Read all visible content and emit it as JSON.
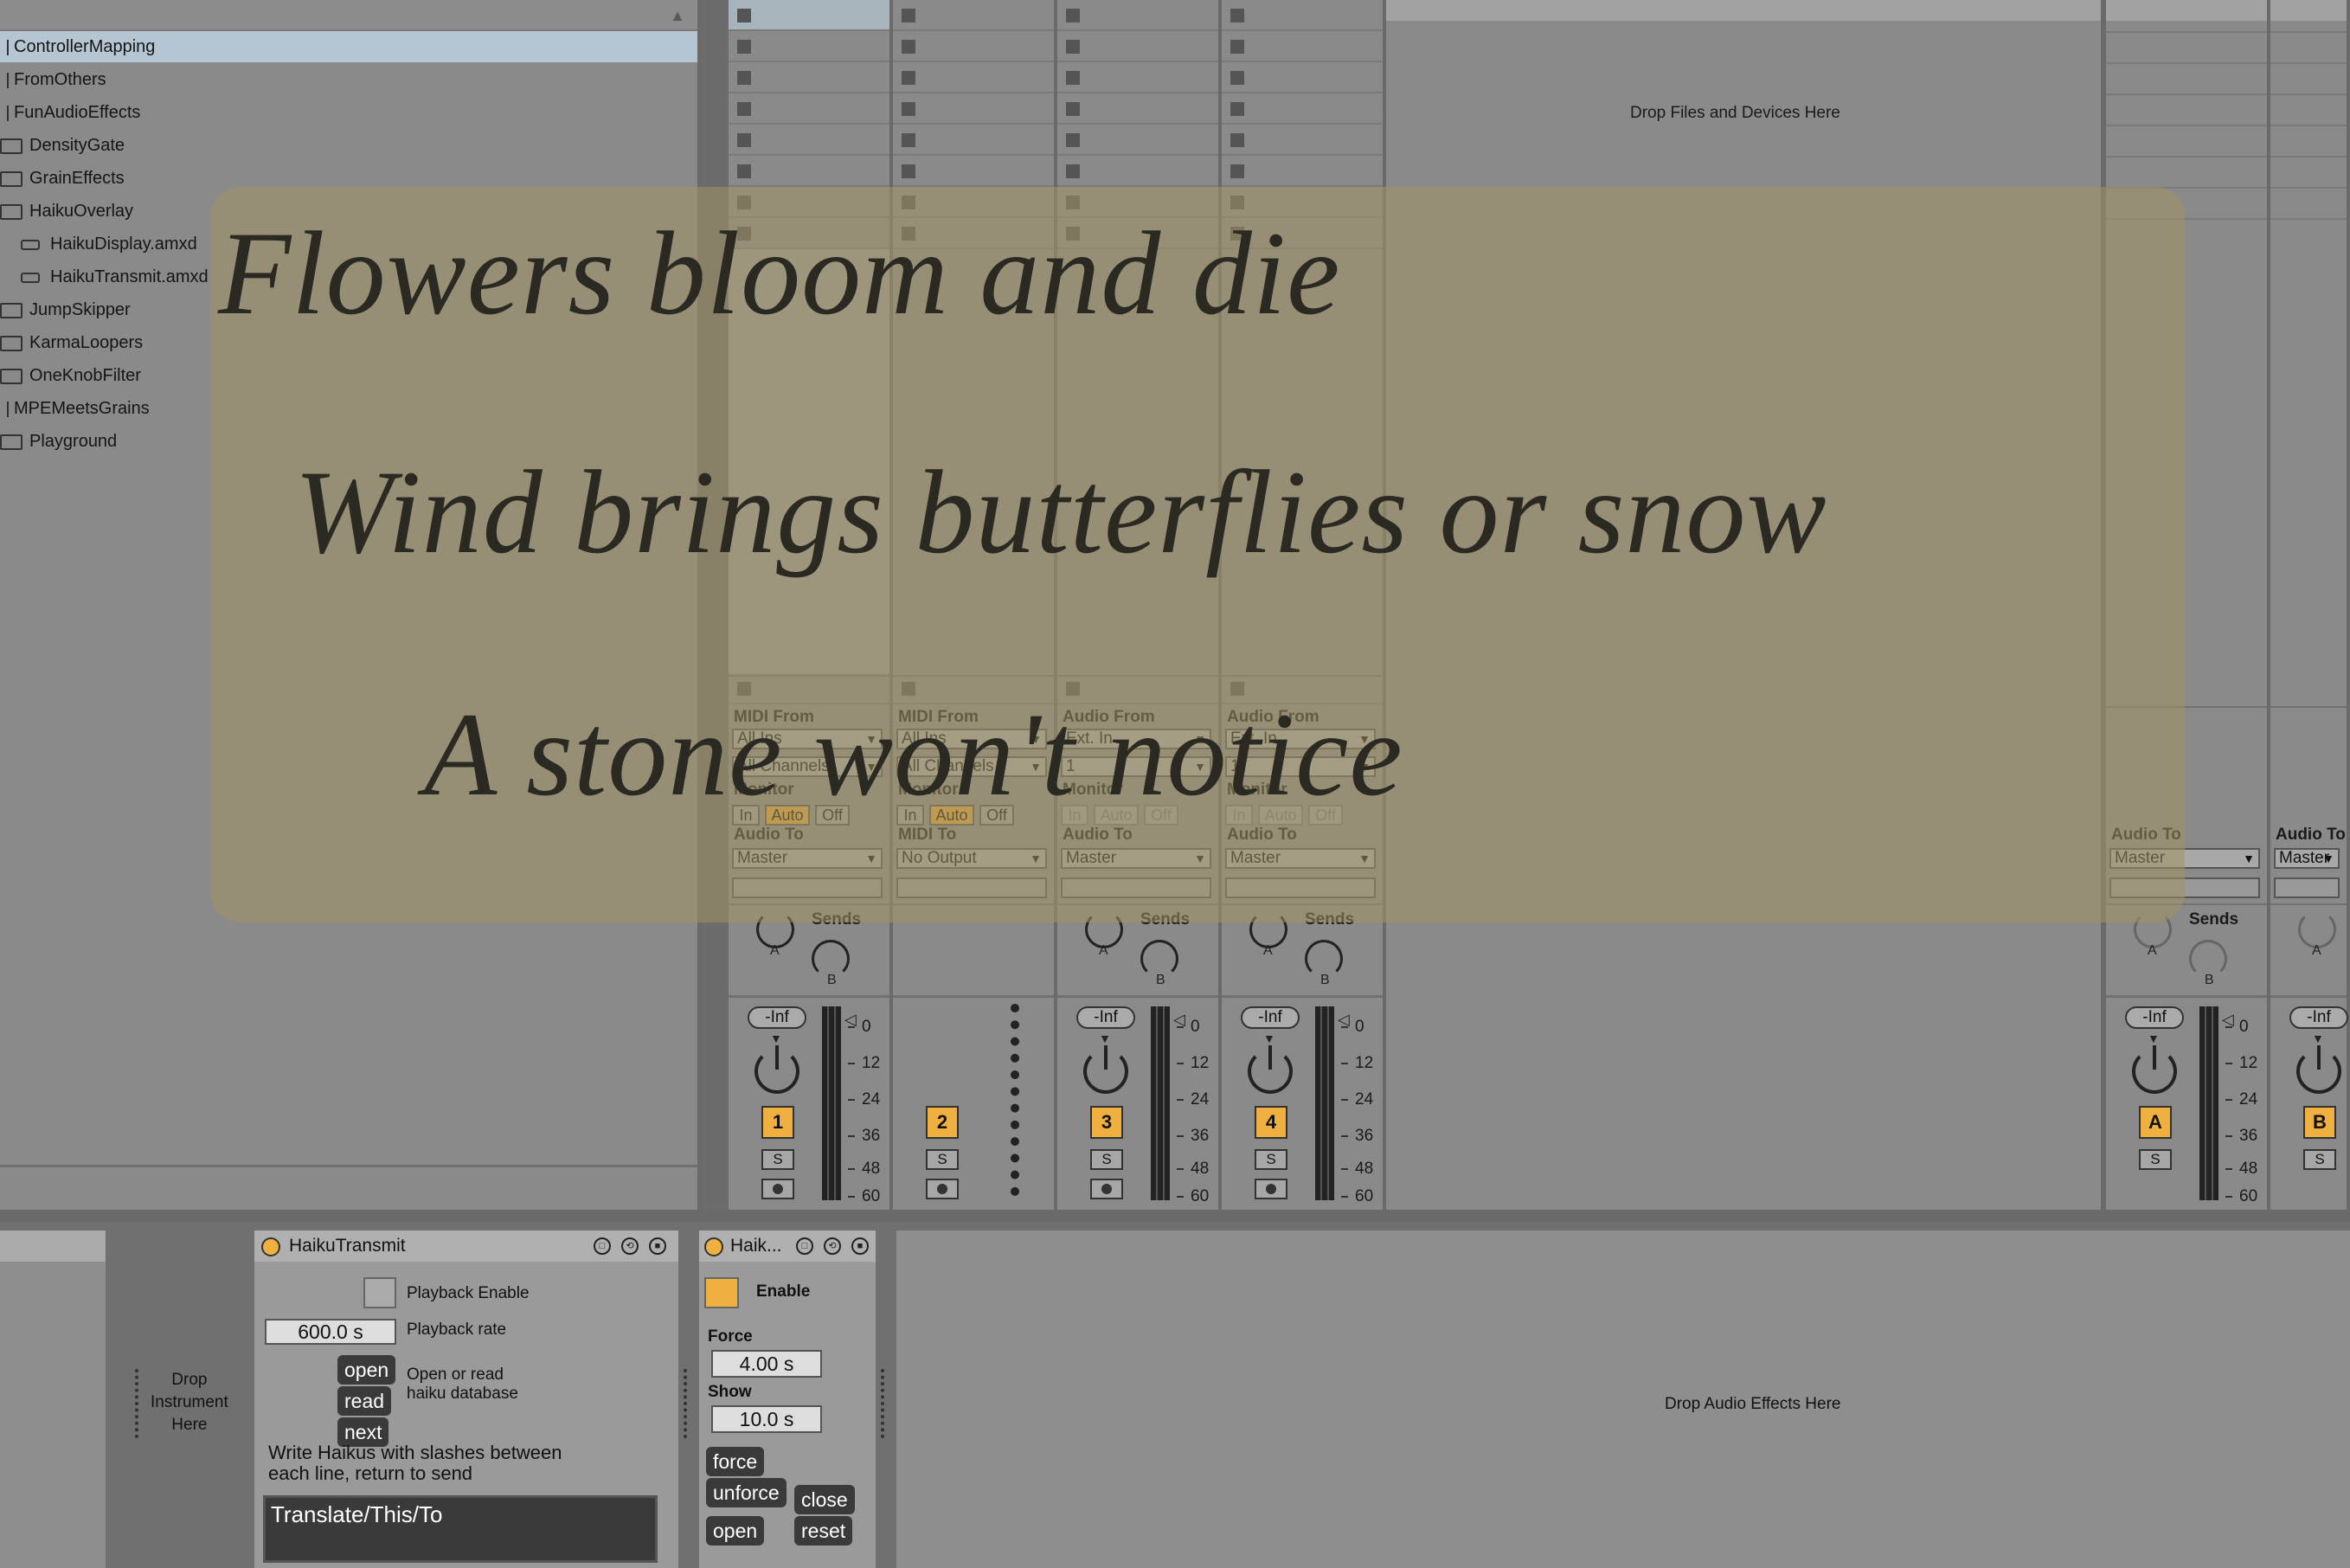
{
  "browser": {
    "items": [
      {
        "label": "ControllerMapping",
        "kind": "none",
        "selected": true
      },
      {
        "label": "FromOthers",
        "kind": "none",
        "selected": false
      },
      {
        "label": "FunAudioEffects",
        "kind": "none",
        "selected": false
      },
      {
        "label": "DensityGate",
        "kind": "folder",
        "selected": false
      },
      {
        "label": "GrainEffects",
        "kind": "folder",
        "selected": false
      },
      {
        "label": "HaikuOverlay",
        "kind": "folder",
        "selected": false
      },
      {
        "label": "HaikuDisplay.amxd",
        "kind": "device",
        "selected": false
      },
      {
        "label": "HaikuTransmit.amxd",
        "kind": "device",
        "selected": false
      },
      {
        "label": "JumpSkipper",
        "kind": "folder",
        "selected": false
      },
      {
        "label": "KarmaLoopers",
        "kind": "folder",
        "selected": false
      },
      {
        "label": "OneKnobFilter",
        "kind": "folder",
        "selected": false
      },
      {
        "label": "MPEMeetsGrains",
        "kind": "none",
        "selected": false
      },
      {
        "label": "Playground",
        "kind": "folder",
        "selected": false
      }
    ]
  },
  "session": {
    "drop_files_label": "Drop Files and Devices Here",
    "tracks": [
      {
        "input_label": "MIDI From",
        "input_source": "All Ins",
        "input_channel": "All Channels",
        "monitor_label": "Monitor",
        "monitor_in": "In",
        "monitor_auto": "Auto",
        "monitor_off": "Off",
        "output_label": "Audio To",
        "output_target": "Master",
        "sends_label": "Sends",
        "send_a": "A",
        "send_b": "B",
        "volume": "-Inf",
        "number": "1",
        "solo": "S"
      },
      {
        "input_label": "MIDI From",
        "input_source": "All Ins",
        "input_channel": "All Channels",
        "monitor_label": "Monitor",
        "monitor_in": "In",
        "monitor_auto": "Auto",
        "monitor_off": "Off",
        "output_label": "MIDI To",
        "output_target": "No Output",
        "number": "2",
        "solo": "S"
      },
      {
        "input_label": "Audio From",
        "input_source": "Ext. In",
        "input_channel": "1",
        "monitor_label": "Monitor",
        "monitor_in": "In",
        "monitor_auto": "Auto",
        "monitor_off": "Off",
        "output_label": "Audio To",
        "output_target": "Master",
        "sends_label": "Sends",
        "send_a": "A",
        "send_b": "B",
        "volume": "-Inf",
        "number": "3",
        "solo": "S"
      },
      {
        "input_label": "Audio From",
        "input_source": "Ext. In",
        "input_channel": "1",
        "monitor_label": "Monitor",
        "monitor_in": "In",
        "monitor_auto": "Auto",
        "monitor_off": "Off",
        "output_label": "Audio To",
        "output_target": "Master",
        "sends_label": "Sends",
        "send_a": "A",
        "send_b": "B",
        "volume": "-Inf",
        "number": "4",
        "solo": "S"
      }
    ],
    "returns": [
      {
        "output_label": "Audio To",
        "output_target": "Master",
        "sends_label": "Sends",
        "send_a": "A",
        "send_b": "B",
        "volume": "-Inf",
        "number": "A",
        "solo": "S"
      },
      {
        "output_label": "Audio To",
        "output_target": "Master",
        "send_a": "A",
        "volume": "-Inf",
        "number": "B",
        "solo": "S"
      }
    ],
    "meter_scale": [
      "0",
      "12",
      "24",
      "36",
      "48",
      "60"
    ]
  },
  "devices": {
    "drop_instrument": "Drop\nInstrument\nHere",
    "drop_audio_effects": "Drop Audio Effects Here",
    "haiku_transmit": {
      "title": "HaikuTransmit",
      "playback_enable": "Playback Enable",
      "playback_rate_value": "600.0 s",
      "playback_rate": "Playback rate",
      "open_btn": "open",
      "read_btn": "read",
      "next_btn": "next",
      "open_or_read": "Open or read",
      "haiku_database": "haiku database",
      "instructions_1": "Write Haikus with slashes between",
      "instructions_2": "each line, return to send",
      "text_entry": "Translate/This/To"
    },
    "haiku_display": {
      "title": "Haik...",
      "enable": "Enable",
      "force_label": "Force",
      "force_value": "4.00 s",
      "show_label": "Show",
      "show_value": "10.0 s",
      "force_btn": "force",
      "unforce_btn": "unforce",
      "close_btn": "close",
      "open_btn": "open",
      "reset_btn": "reset"
    }
  },
  "overlay": {
    "line1": "Flowers bloom and die",
    "line2": "Wind brings butterflies or snow",
    "line3": "A stone won't notice"
  }
}
